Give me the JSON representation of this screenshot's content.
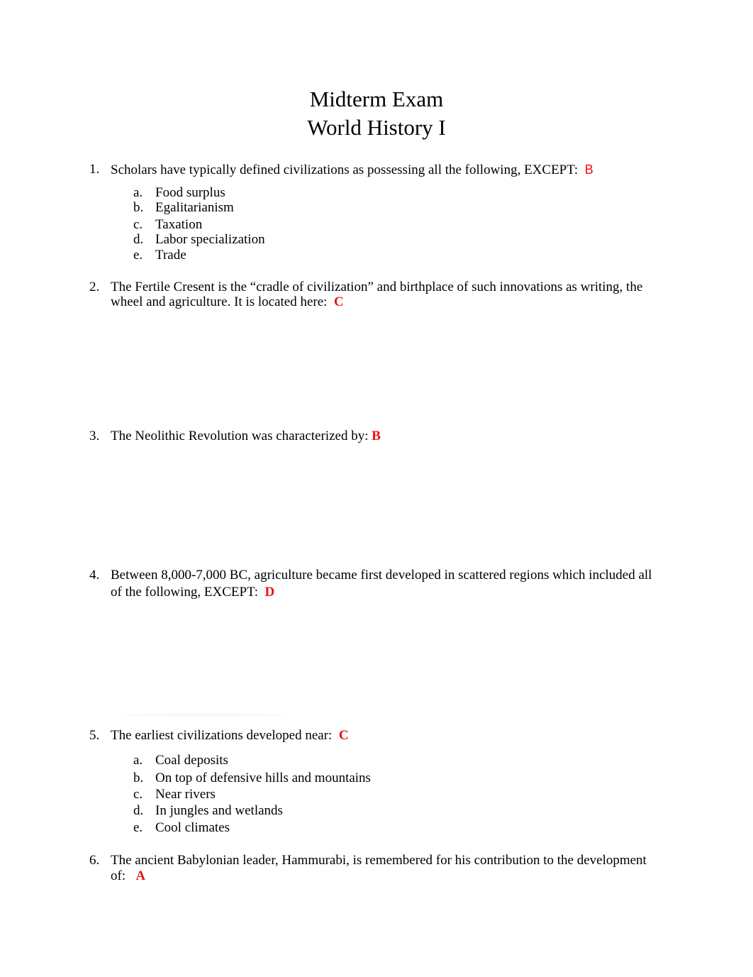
{
  "document": {
    "title_line1": "Midterm Exam",
    "title_line2": "World History I",
    "answer_color": "#ee1111"
  },
  "questions": [
    {
      "number": "1.",
      "lines": [
        "Scholars have typically defined civilizations as possessing all the following, EXCEPT:  "
      ],
      "answer": "B",
      "options": [
        {
          "letter": "a.",
          "text": "Food surplus"
        },
        {
          "letter": "b.",
          "text": "Egalitarianism"
        },
        {
          "letter": "c.",
          "text": "Taxation"
        },
        {
          "letter": "d.",
          "text": "Labor specialization"
        },
        {
          "letter": "e.",
          "text": "Trade"
        }
      ]
    },
    {
      "number": "2.",
      "lines": [
        "The Fertile Cresent is the “cradle of civilization” and birthplace of such innovations as writing, the",
        "wheel and agriculture. It is located here:  "
      ],
      "answer": "C",
      "options": []
    },
    {
      "number": "3.",
      "lines": [
        "The Neolithic Revolution was characterized by: "
      ],
      "answer": "B",
      "options": []
    },
    {
      "number": "4.",
      "lines": [
        "Between 8,000-7,000 BC, agriculture became first developed in scattered regions which included all",
        "of the following, EXCEPT:  "
      ],
      "answer": "D",
      "options": []
    },
    {
      "number": "5.",
      "lines": [
        "The earliest civilizations developed near:  "
      ],
      "answer": "C",
      "options": [
        {
          "letter": "a.",
          "text": "Coal deposits"
        },
        {
          "letter": "b.",
          "text": "On top of defensive hills and mountains"
        },
        {
          "letter": "c.",
          "text": "Near rivers"
        },
        {
          "letter": "d.",
          "text": "In jungles and wetlands"
        },
        {
          "letter": "e.",
          "text": "Cool climates"
        }
      ]
    },
    {
      "number": "6.",
      "lines": [
        "The ancient Babylonian leader, Hammurabi, is remembered for his contribution to the development",
        "of:   "
      ],
      "answer": "A",
      "options": []
    }
  ]
}
